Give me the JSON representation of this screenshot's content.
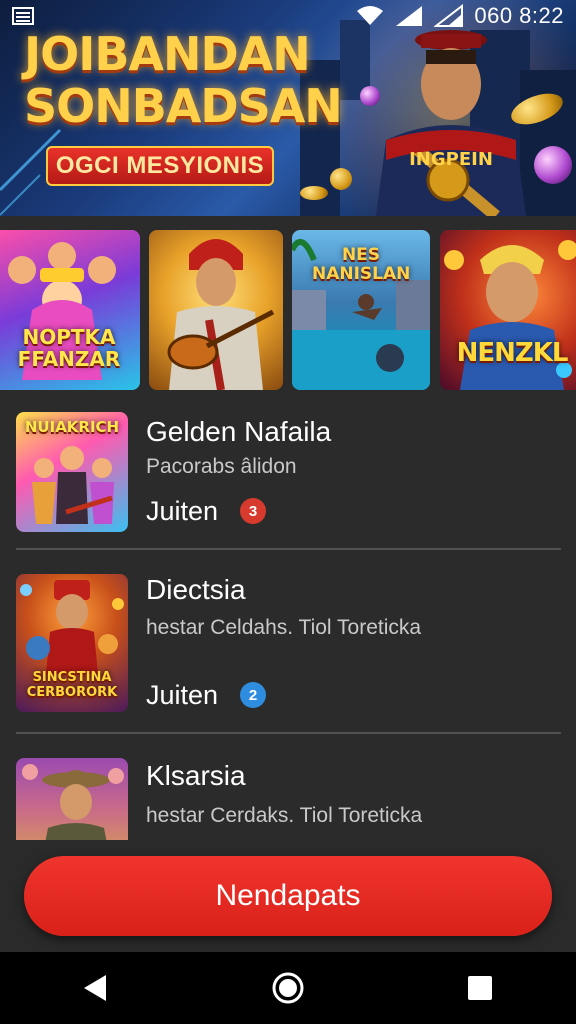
{
  "status": {
    "time": "060 8:22",
    "icons": [
      "notification-icon",
      "wifi-icon",
      "signal-icon",
      "battery-icon"
    ]
  },
  "banner": {
    "title_line1": "JOIBANDAN",
    "title_line2": "SONBADSAN",
    "badge": "OGCI MESYIONIS",
    "hero_shirt_text": "INGPEIN"
  },
  "thumbnails": [
    {
      "label": "NOPTKA FFANZAR"
    },
    {
      "label": ""
    },
    {
      "label": "NES NANISLAN"
    },
    {
      "label": "NENZKL"
    }
  ],
  "games": [
    {
      "title": "Gelden Nafaila",
      "subtitle": "Pacorabs âlidon",
      "tag": "Juiten",
      "badge": "3",
      "badge_color": "#d83a2e",
      "thumb_label": "NUIAKRICH"
    },
    {
      "title": "Diectsia",
      "subtitle": "hestar Celdahs. Tiol Toreticka",
      "tag": "Juiten",
      "badge": "2",
      "badge_color": "#2f8de0",
      "thumb_label": "SINCSTINA CERBORORK"
    },
    {
      "title": "Klsarsia",
      "subtitle": "hestar Cerdaks. Tiol Toreticka",
      "tag": "",
      "badge": "",
      "badge_color": "",
      "thumb_label": ""
    }
  ],
  "cta": {
    "label": "Nendapats"
  },
  "colors": {
    "accent": "#e52a22",
    "background": "#2b2b2b",
    "nav": "#000000"
  }
}
